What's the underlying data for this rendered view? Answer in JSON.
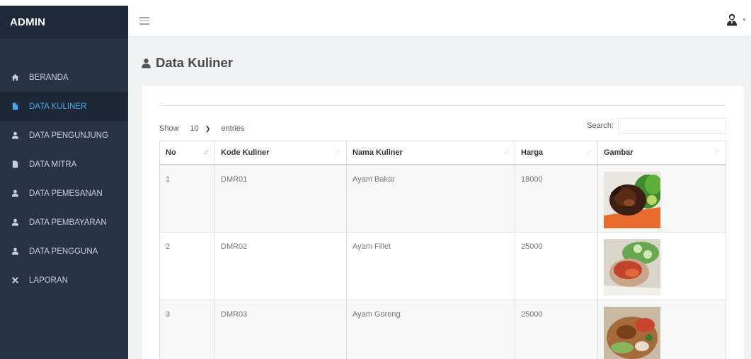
{
  "sidebar": {
    "brand": "ADMIN",
    "items": [
      {
        "label": "BERANDA",
        "icon": "home-icon",
        "active": false
      },
      {
        "label": "DATA KULINER",
        "icon": "file-icon",
        "active": true
      },
      {
        "label": "DATA PENGUNJUNG",
        "icon": "user-icon",
        "active": false
      },
      {
        "label": "DATA MITRA",
        "icon": "file-icon",
        "active": false
      },
      {
        "label": "DATA PEMESANAN",
        "icon": "user-icon",
        "active": false
      },
      {
        "label": "DATA PEMBAYARAN",
        "icon": "user-icon",
        "active": false
      },
      {
        "label": "DATA PENGGUNA",
        "icon": "user-icon",
        "active": false
      },
      {
        "label": "LAPORAN",
        "icon": "tools-icon",
        "active": false
      }
    ]
  },
  "topbar": {
    "menu_icon": "hamburger-icon",
    "user_icon": "user-avatar-icon",
    "user_caret": "▾"
  },
  "page": {
    "title": "Data Kuliner",
    "title_icon": "user-icon"
  },
  "table_controls": {
    "show_label": "Show",
    "entries_value": "10",
    "entries_label": "entries",
    "search_label": "Search:",
    "search_value": ""
  },
  "table": {
    "columns": [
      "No",
      "Kode Kuliner",
      "Nama Kuliner",
      "Harga",
      "Gambar"
    ],
    "rows": [
      {
        "no": "1",
        "kode": "DMR01",
        "nama": "Ayam Bakar",
        "harga": "18000",
        "gambar": "ayam-bakar-image"
      },
      {
        "no": "2",
        "kode": "DMR02",
        "nama": "Ayam Fillet",
        "harga": "25000",
        "gambar": "ayam-fillet-image"
      },
      {
        "no": "3",
        "kode": "DMR03",
        "nama": "Ayam Goreng",
        "harga": "25000",
        "gambar": "ayam-goreng-image"
      }
    ]
  },
  "colors": {
    "sidebar_bg": "#263446",
    "brand_bg": "#1e2a39",
    "active_text": "#4ea7e6",
    "content_bg": "#f1f2f4"
  }
}
